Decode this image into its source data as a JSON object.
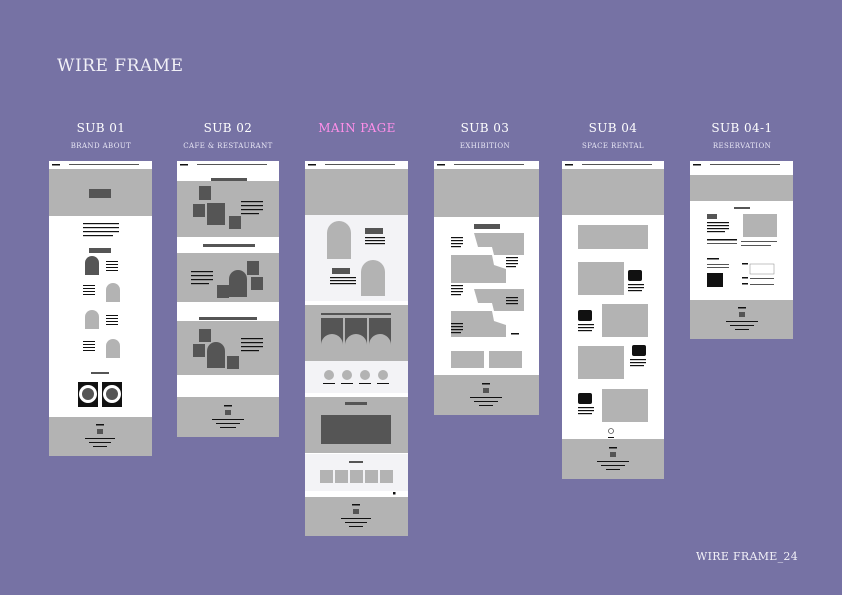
{
  "header": {
    "title": "WIRE FRAME"
  },
  "footer": {
    "label": "WIRE FRAME_24"
  },
  "columns": [
    {
      "title": "SUB 01",
      "subtitle": "BRAND ABOUT",
      "highlight": false
    },
    {
      "title": "SUB 02",
      "subtitle": "CAFE & RESTAURANT",
      "highlight": false
    },
    {
      "title": "MAIN PAGE",
      "subtitle": "",
      "highlight": true
    },
    {
      "title": "SUB 03",
      "subtitle": "EXHIBITION",
      "highlight": false
    },
    {
      "title": "SUB 04",
      "subtitle": "SPACE RENTAL",
      "highlight": false
    },
    {
      "title": "SUB 04-1",
      "subtitle": "RESERVATION",
      "highlight": false
    }
  ],
  "colors": {
    "background": "#7672a4",
    "highlight": "#ff8fe9",
    "wireframe_block": "#b3b3b3",
    "wireframe_dark": "#555555"
  }
}
